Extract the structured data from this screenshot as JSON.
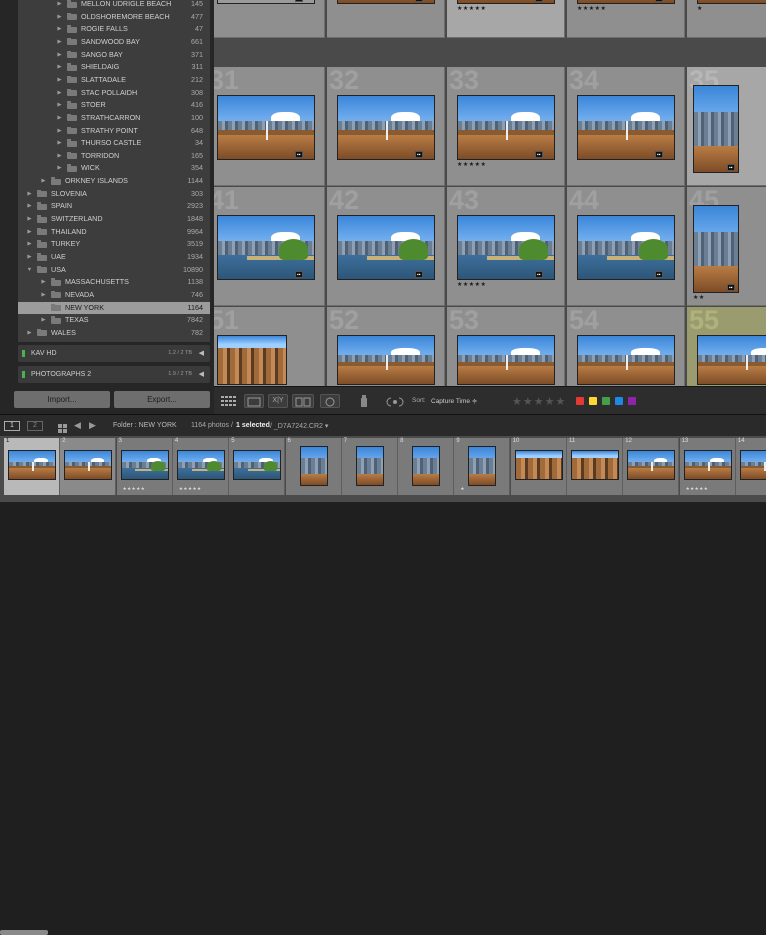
{
  "folders": [
    {
      "name": "MELLON UDRIGLE BEACH",
      "count": "145",
      "level": 3
    },
    {
      "name": "OLDSHOREMORE BEACH",
      "count": "477",
      "level": 3
    },
    {
      "name": "ROGIE FALLS",
      "count": "47",
      "level": 3
    },
    {
      "name": "SANDWOOD BAY",
      "count": "661",
      "level": 3
    },
    {
      "name": "SANGO BAY",
      "count": "371",
      "level": 3
    },
    {
      "name": "SHIELDAIG",
      "count": "311",
      "level": 3
    },
    {
      "name": "SLATTADALE",
      "count": "212",
      "level": 3
    },
    {
      "name": "STAC POLLAIDH",
      "count": "308",
      "level": 3
    },
    {
      "name": "STOER",
      "count": "416",
      "level": 3
    },
    {
      "name": "STRATHCARRON",
      "count": "100",
      "level": 3
    },
    {
      "name": "STRATHY POINT",
      "count": "648",
      "level": 3
    },
    {
      "name": "THURSO CASTLE",
      "count": "34",
      "level": 3
    },
    {
      "name": "TORRIDON",
      "count": "165",
      "level": 3
    },
    {
      "name": "WICK",
      "count": "354",
      "level": 3
    },
    {
      "name": "ORKNEY ISLANDS",
      "count": "1144",
      "level": 2
    },
    {
      "name": "SLOVENIA",
      "count": "303",
      "level": 1
    },
    {
      "name": "SPAIN",
      "count": "2923",
      "level": 1
    },
    {
      "name": "SWITZERLAND",
      "count": "1848",
      "level": 1
    },
    {
      "name": "THAILAND",
      "count": "9964",
      "level": 1
    },
    {
      "name": "TURKEY",
      "count": "3519",
      "level": 1
    },
    {
      "name": "UAE",
      "count": "1934",
      "level": 1
    },
    {
      "name": "USA",
      "count": "10890",
      "level": 1,
      "open": true
    },
    {
      "name": "MASSACHUSETTS",
      "count": "1138",
      "level": 2
    },
    {
      "name": "NEVADA",
      "count": "746",
      "level": 2
    },
    {
      "name": "NEW YORK",
      "count": "1164",
      "level": 2,
      "selected": true
    },
    {
      "name": "TEXAS",
      "count": "7842",
      "level": 2
    },
    {
      "name": "WALES",
      "count": "782",
      "level": 1
    }
  ],
  "volumes": [
    {
      "name": "KAV HD",
      "size": "1.2 / 2 TB"
    },
    {
      "name": "PHOTOGRAPHS 2",
      "size": "1.9 / 2 TB"
    }
  ],
  "buttons": {
    "import": "Import...",
    "export": "Export..."
  },
  "toolbar": {
    "sort_label": "Sort:",
    "sort_value": "Capture Time ≑",
    "stars": "★★★★★",
    "xy": "X|Y"
  },
  "color_labels": [
    "#e53935",
    "#fdd835",
    "#43a047",
    "#1e88e5",
    "#8e24aa"
  ],
  "filmstrip_bar": {
    "page1": "1",
    "page2": "2",
    "folder": "Folder : NEW YORK",
    "info_pre": "1164 photos /",
    "info_sel": "1 selected",
    "info_post": "/ _D7A7242.CR2 ▾"
  },
  "grid": {
    "row_numbers": [
      [
        "",
        "",
        "",
        ""
      ],
      [
        "31",
        "32",
        "33",
        "34",
        "35"
      ],
      [
        "41",
        "42",
        "43",
        "44",
        "45"
      ],
      [
        "51",
        "52",
        "53",
        "54",
        "55"
      ]
    ],
    "ratings": [
      "★★★★★",
      "★★★★★",
      "★★★★★",
      "★",
      "★★★★★",
      "★★★★★",
      "★★"
    ]
  },
  "filmstrip_numbers": [
    "1",
    "2",
    "3",
    "4",
    "5",
    "6",
    "7",
    "8",
    "9",
    "10",
    "11",
    "12",
    "13",
    "14"
  ],
  "filmstrip_stars": [
    "★★★★★",
    "★★★★★",
    "★",
    "★★★★★"
  ]
}
